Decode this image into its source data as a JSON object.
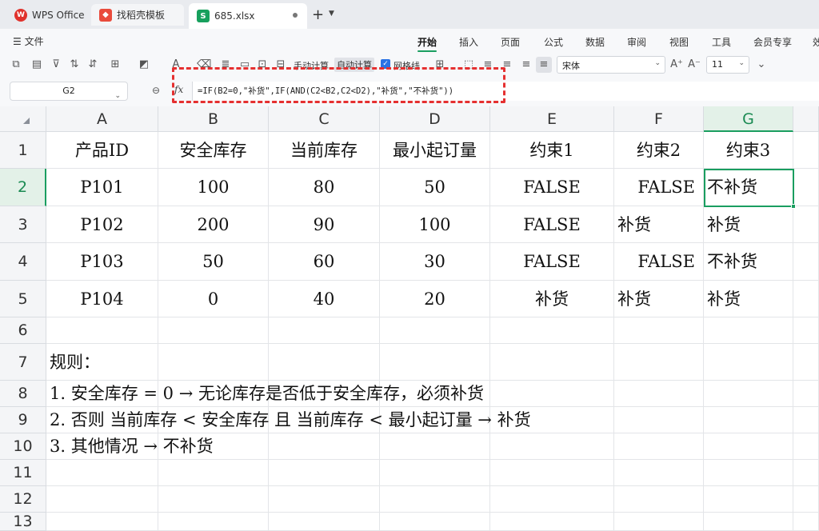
{
  "tabs": [
    {
      "label": "WPS Office",
      "icon": "wps-logo-icon"
    },
    {
      "label": "找稻壳模板",
      "icon": "docer-icon"
    },
    {
      "label": "685.xlsx",
      "icon": "sheet-icon"
    }
  ],
  "menu": {
    "file_label": "文件",
    "items": [
      "开始",
      "插入",
      "页面",
      "公式",
      "数据",
      "审阅",
      "视图",
      "工具",
      "会员专享",
      "效"
    ],
    "active": "开始"
  },
  "toolbar": {
    "manual_calc": "手动计算",
    "auto_calc": "自动计算",
    "gridlines_label": "网格线",
    "gridlines_checked": true,
    "font_name": "宋体",
    "font_size": "11"
  },
  "formula_bar": {
    "cell_ref": "G2",
    "fx_label": "fx",
    "formula": "=IF(B2=0,\"补货\",IF(AND(C2<B2,C2<D2),\"补货\",\"不补货\"))"
  },
  "sheet": {
    "columns": [
      "A",
      "B",
      "C",
      "D",
      "E",
      "F",
      "G"
    ],
    "rows": [
      "1",
      "2",
      "3",
      "4",
      "5",
      "6",
      "7",
      "8",
      "9",
      "10",
      "11",
      "12",
      "13"
    ],
    "selected_cell": "G2",
    "header": [
      "产品ID",
      "安全库存",
      "当前库存",
      "最小起订量",
      "约束1",
      "约束2",
      "约束3"
    ],
    "data": [
      [
        "P101",
        "100",
        "80",
        "50",
        "FALSE",
        "FALSE",
        "不补货"
      ],
      [
        "P102",
        "200",
        "90",
        "100",
        "FALSE",
        "补货",
        "补货"
      ],
      [
        "P103",
        "50",
        "60",
        "30",
        "FALSE",
        "FALSE",
        "不补货"
      ],
      [
        "P104",
        "0",
        "40",
        "20",
        "补货",
        "补货",
        "补货"
      ]
    ],
    "notes": [
      "规则：",
      "1. 安全库存 = 0 → 无论库存是否低于安全库存，必须补货",
      "2. 否则 当前库存 < 安全库存 且 当前库存 < 最小起订量 → 补货",
      "3. 其他情况 → 不补货"
    ]
  },
  "colors": {
    "accent": "#1a9e60",
    "highlight_box": "#e53030"
  }
}
